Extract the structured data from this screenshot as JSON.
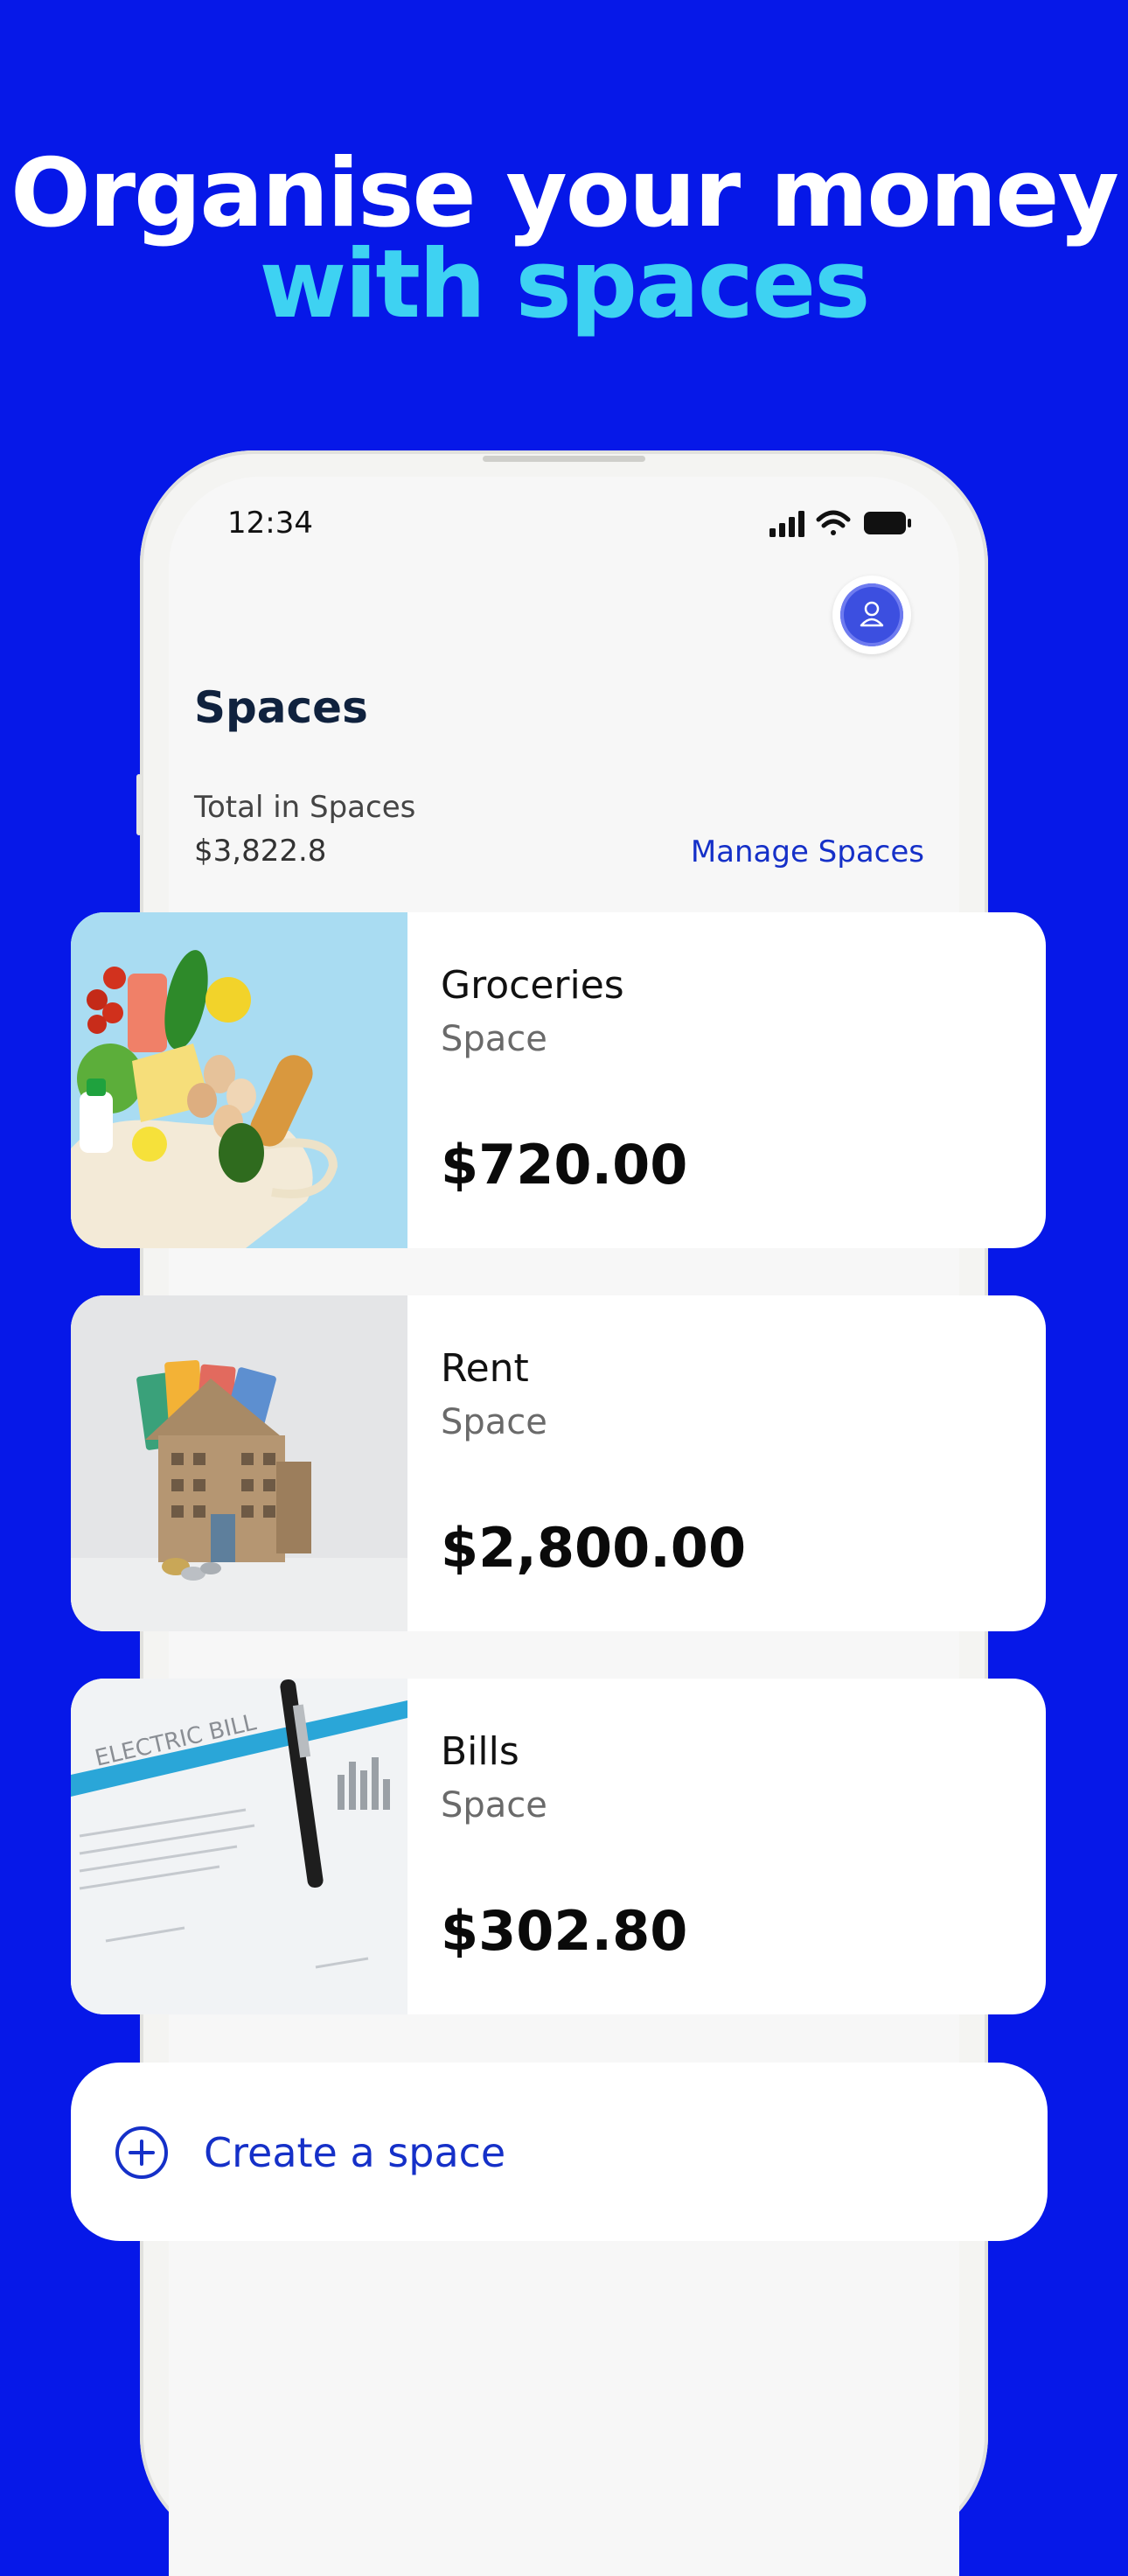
{
  "headline": {
    "line1": "Organise your money",
    "line2": "with spaces"
  },
  "status_bar": {
    "time": "12:34"
  },
  "spaces_screen": {
    "title": "Spaces",
    "total_label": "Total in Spaces",
    "total_value": "$3,822.8",
    "manage_link": "Manage Spaces"
  },
  "spaces": [
    {
      "name": "Groceries",
      "type": "Space",
      "amount": "$720.00",
      "image": "groceries-bag-photo"
    },
    {
      "name": "Rent",
      "type": "Space",
      "amount": "$2,800.00",
      "image": "house-with-banknotes-photo"
    },
    {
      "name": "Bills",
      "type": "Space",
      "amount": "$302.80",
      "image": "electric-bill-with-pen-photo"
    }
  ],
  "bill_image_text": "ELECTRIC BILL",
  "create_button": {
    "label": "Create a space"
  },
  "colors": {
    "background": "#0618E8",
    "accent": "#3ED2F2",
    "link": "#1530C8"
  }
}
